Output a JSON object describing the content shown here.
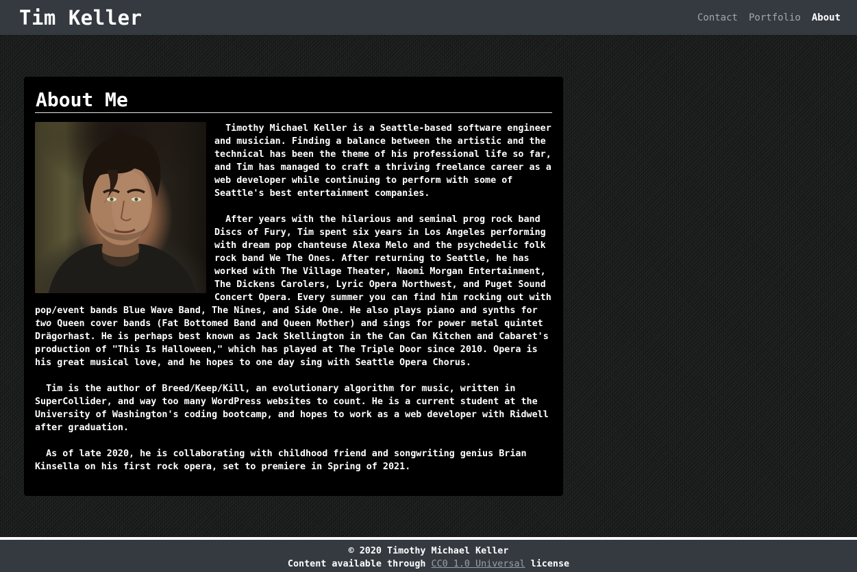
{
  "header": {
    "brand": "Tim Keller",
    "nav": [
      {
        "label": "Contact",
        "active": false
      },
      {
        "label": "Portfolio",
        "active": false
      },
      {
        "label": "About",
        "active": true
      }
    ]
  },
  "about": {
    "title": "About Me",
    "photo_alt": "Portrait of Tim Keller",
    "paragraphs": [
      "Timothy Michael Keller is a Seattle-based software engineer and musician. Finding a balance between the artistic and the technical has been the theme of his professional life so far, and Tim has managed to craft a thriving freelance career as a web developer while continuing to perform with some of Seattle's best entertainment companies.",
      {
        "before": "After years with the hilarious and seminal prog rock band Discs of Fury, Tim spent six years in Los Angeles performing with dream pop chanteuse Alexa Melo and the psychedelic folk rock band We The Ones. After returning to Seattle, he has worked with The Village Theater, Naomi Morgan Entertainment, The Dickens Carolers, Lyric Opera Northwest, and Puget Sound Concert Opera. Every summer you can find him rocking out with pop/event bands Blue Wave Band, The Nines, and Side One. He also plays piano and synths for ",
        "emphasis": "two",
        "after": " Queen cover bands (Fat Bottomed Band and Queen Mother) and sings for power metal quintet Drägorhast. He is perhaps best known as Jack Skellington in the Can Can Kitchen and Cabaret's production of \"This Is Halloween,\" which has played at The Triple Door since 2010. Opera is his great musical love, and he hopes to one day sing with Seattle Opera Chorus."
      },
      "Tim is the author of Breed/Keep/Kill, an evolutionary algorithm for music, written in SuperCollider, and way too many WordPress websites to count. He is a current student at the University of Washington's coding bootcamp, and hopes to work as a web developer with Ridwell after graduation.",
      "As of late 2020, he is collaborating with childhood friend and songwriting genius Brian Kinsella on his first rock opera, set to premiere in Spring of 2021."
    ]
  },
  "footer": {
    "copyright": "© 2020 Timothy Michael Keller",
    "license_prefix": "Content available through ",
    "license_link": "CC0 1.0 Universal",
    "license_suffix": " license"
  },
  "colors": {
    "navbar_bg": "#343a40",
    "card_bg": "#000000",
    "text": "#ffffff",
    "muted_link": "#9aa0a6"
  }
}
